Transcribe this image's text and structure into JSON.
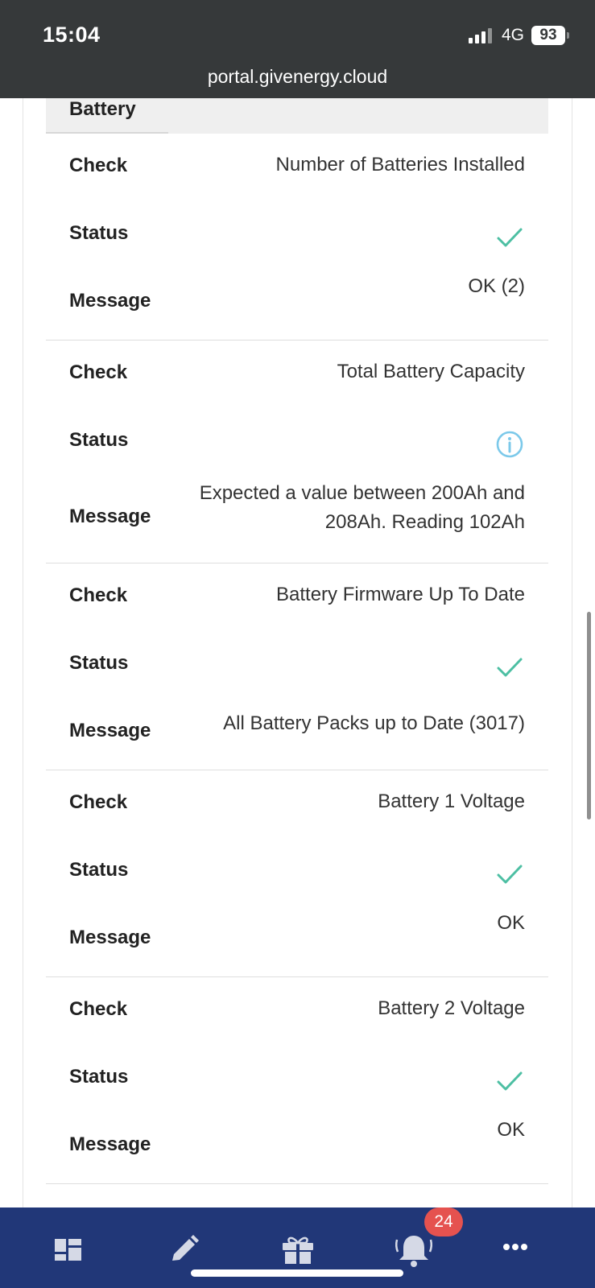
{
  "status_bar": {
    "time": "15:04",
    "network": "4G",
    "battery": "93",
    "url": "portal.givenergy.cloud"
  },
  "section": {
    "title": "Battery"
  },
  "labels": {
    "check": "Check",
    "status": "Status",
    "message": "Message"
  },
  "checks": [
    {
      "check": "Number of Batteries Installed",
      "status": "ok",
      "message": "OK (2)"
    },
    {
      "check": "Total Battery Capacity",
      "status": "info",
      "message": "Expected a value between 200Ah and 208Ah. Reading 102Ah"
    },
    {
      "check": "Battery Firmware Up To Date",
      "status": "ok",
      "message": "All Battery Packs up to Date (3017)"
    },
    {
      "check": "Battery 1 Voltage",
      "status": "ok",
      "message": "OK"
    },
    {
      "check": "Battery 2 Voltage",
      "status": "ok",
      "message": "OK"
    }
  ],
  "nav": {
    "items": [
      "dashboard-icon",
      "edit-icon",
      "gift-icon",
      "bell-icon",
      "more-icon"
    ],
    "notification_count": "24"
  },
  "colors": {
    "ok": "#4dbfa3",
    "info": "#7cc9ea",
    "nav_bg": "#213778",
    "badge": "#e5524f"
  }
}
